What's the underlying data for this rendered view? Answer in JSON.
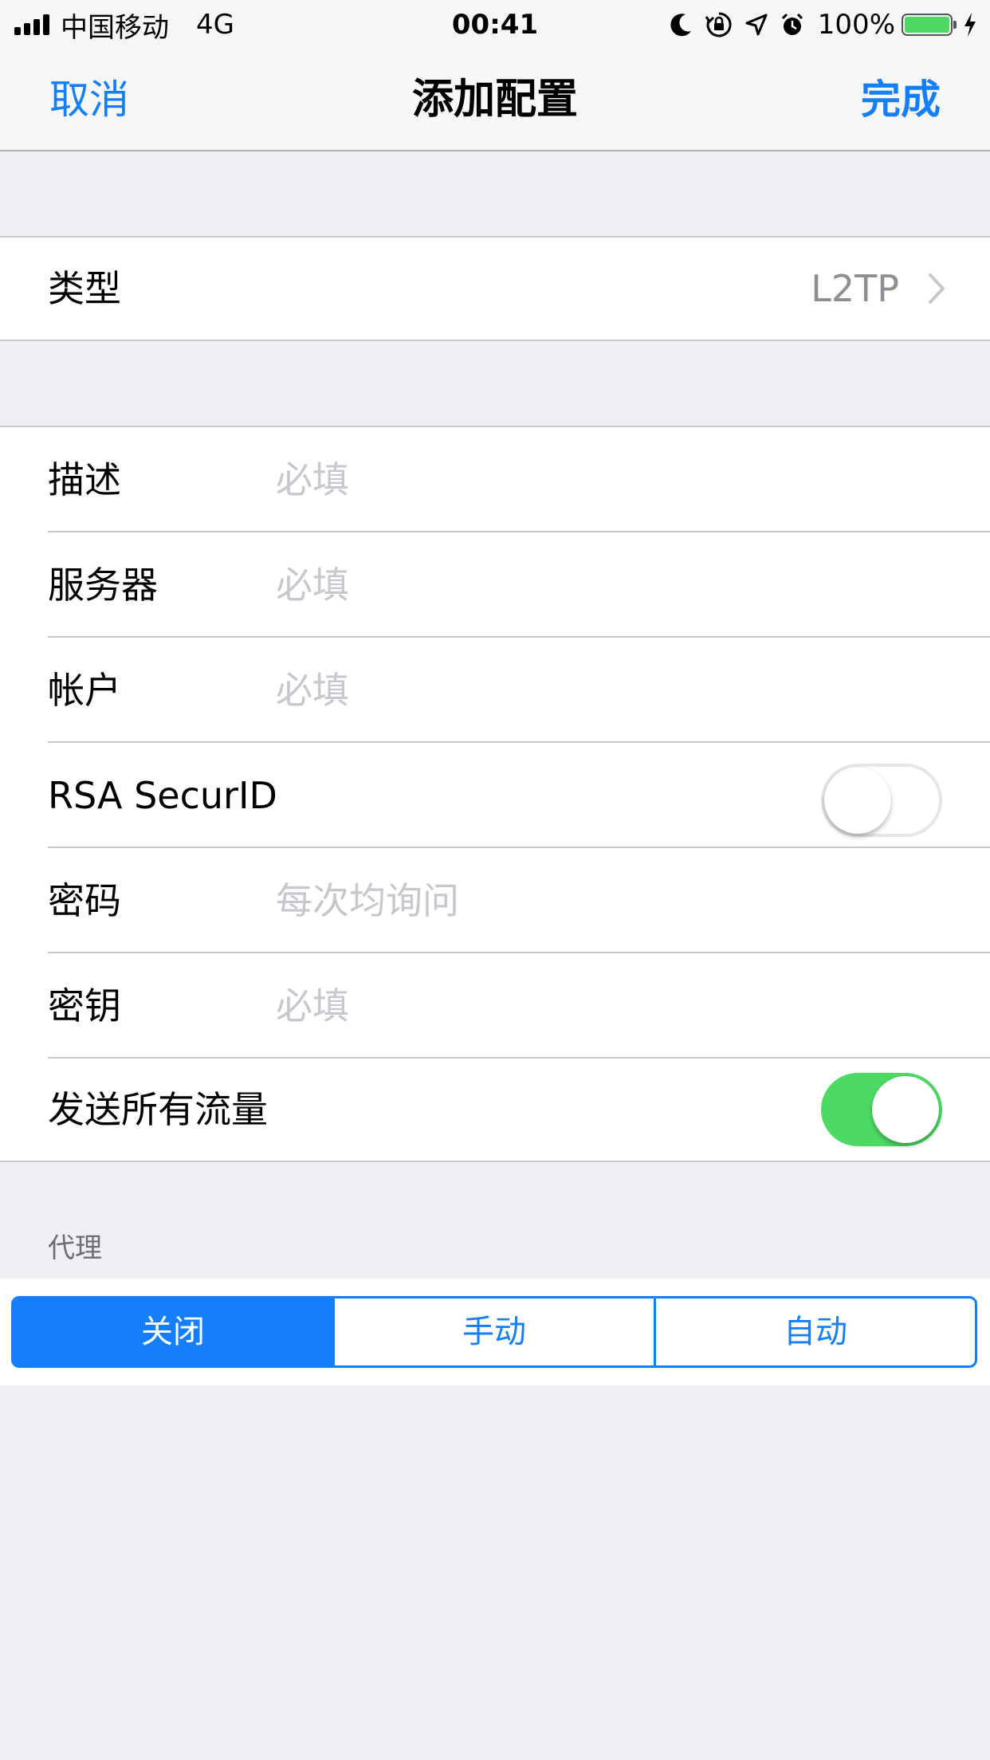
{
  "status_bar": {
    "carrier": "中国移动",
    "network": "4G",
    "time": "00:41",
    "battery_percent": "100%",
    "battery_level": 1.0,
    "icons": [
      "moon-icon",
      "rotation-lock-icon",
      "location-icon",
      "alarm-icon",
      "charging-icon"
    ]
  },
  "nav": {
    "cancel": "取消",
    "title": "添加配置",
    "done": "完成"
  },
  "type_row": {
    "label": "类型",
    "value": "L2TP"
  },
  "fields": {
    "description": {
      "label": "描述",
      "placeholder": "必填"
    },
    "server": {
      "label": "服务器",
      "placeholder": "必填"
    },
    "account": {
      "label": "帐户",
      "placeholder": "必填"
    },
    "rsa": {
      "label": "RSA SecurID",
      "on": false
    },
    "password": {
      "label": "密码",
      "placeholder": "每次均询问"
    },
    "secret": {
      "label": "密钥",
      "placeholder": "必填"
    },
    "send_all_traffic": {
      "label": "发送所有流量",
      "on": true
    }
  },
  "proxy": {
    "header": "代理",
    "options": [
      "关闭",
      "手动",
      "自动"
    ],
    "selected": "关闭"
  },
  "colors": {
    "accent": "#147efb",
    "toggle_on": "#4cd964",
    "background": "#efeff4",
    "placeholder": "#c7c7cd"
  }
}
